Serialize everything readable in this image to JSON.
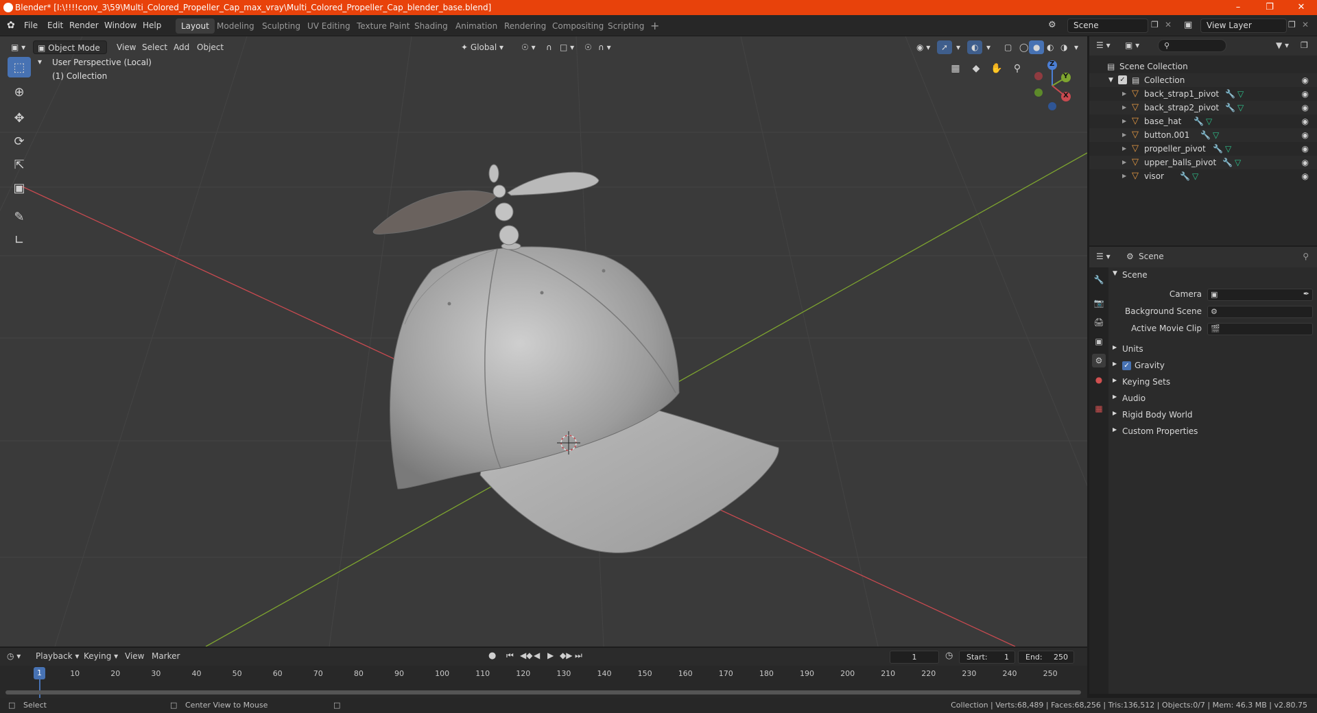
{
  "window": {
    "title": "Blender* [I:\\!!!!conv_3\\59\\Multi_Colored_Propeller_Cap_max_vray\\Multi_Colored_Propeller_Cap_blender_base.blend]"
  },
  "menubar": {
    "items": [
      "File",
      "Edit",
      "Render",
      "Window",
      "Help"
    ],
    "workspaces": [
      "Layout",
      "Modeling",
      "Sculpting",
      "UV Editing",
      "Texture Paint",
      "Shading",
      "Animation",
      "Rendering",
      "Compositing",
      "Scripting"
    ],
    "active_workspace": "Layout",
    "scene": "Scene",
    "view_layer": "View Layer"
  },
  "viewport": {
    "mode": "Object Mode",
    "menus": [
      "View",
      "Select",
      "Add",
      "Object"
    ],
    "orientation": "Global",
    "perspective_label": "User Perspective (Local)",
    "collection_label": "(1) Collection",
    "gizmo": {
      "x": "X",
      "y": "Y",
      "z": "Z"
    }
  },
  "outliner": {
    "root": "Scene Collection",
    "collection": "Collection",
    "objects": [
      {
        "name": "back_strap1_pivot"
      },
      {
        "name": "back_strap2_pivot"
      },
      {
        "name": "base_hat"
      },
      {
        "name": "button.001"
      },
      {
        "name": "propeller_pivot"
      },
      {
        "name": "upper_balls_pivot"
      },
      {
        "name": "visor"
      }
    ]
  },
  "properties": {
    "context": "Scene",
    "panel_title": "Scene",
    "camera_label": "Camera",
    "background_scene_label": "Background Scene",
    "active_movie_clip_label": "Active Movie Clip",
    "sections": [
      "Units",
      "Gravity",
      "Keying Sets",
      "Audio",
      "Rigid Body World",
      "Custom Properties"
    ],
    "gravity_enabled": true
  },
  "timeline": {
    "menus": [
      "Playback",
      "Keying",
      "View",
      "Marker"
    ],
    "current_frame": "1",
    "start_label": "Start:",
    "start": "1",
    "end_label": "End:",
    "end": "250",
    "ticks": [
      "1",
      "10",
      "20",
      "30",
      "40",
      "50",
      "60",
      "70",
      "80",
      "90",
      "100",
      "110",
      "120",
      "130",
      "140",
      "150",
      "160",
      "170",
      "180",
      "190",
      "200",
      "210",
      "220",
      "230",
      "240",
      "250"
    ]
  },
  "statusbar": {
    "left_action": "Select",
    "middle_action": "Center View to Mouse",
    "stats": "Collection | Verts:68,489 | Faces:68,256 | Tris:136,512 | Objects:0/7 | Mem: 46.3 MB | v2.80.75"
  },
  "colors": {
    "title_bar": "#e8420b",
    "accent": "#4772b3",
    "object_icon": "#e79a43",
    "mesh_icon": "#2ec38d",
    "axis_x": "#c94a50",
    "axis_y": "#7ea52f"
  }
}
